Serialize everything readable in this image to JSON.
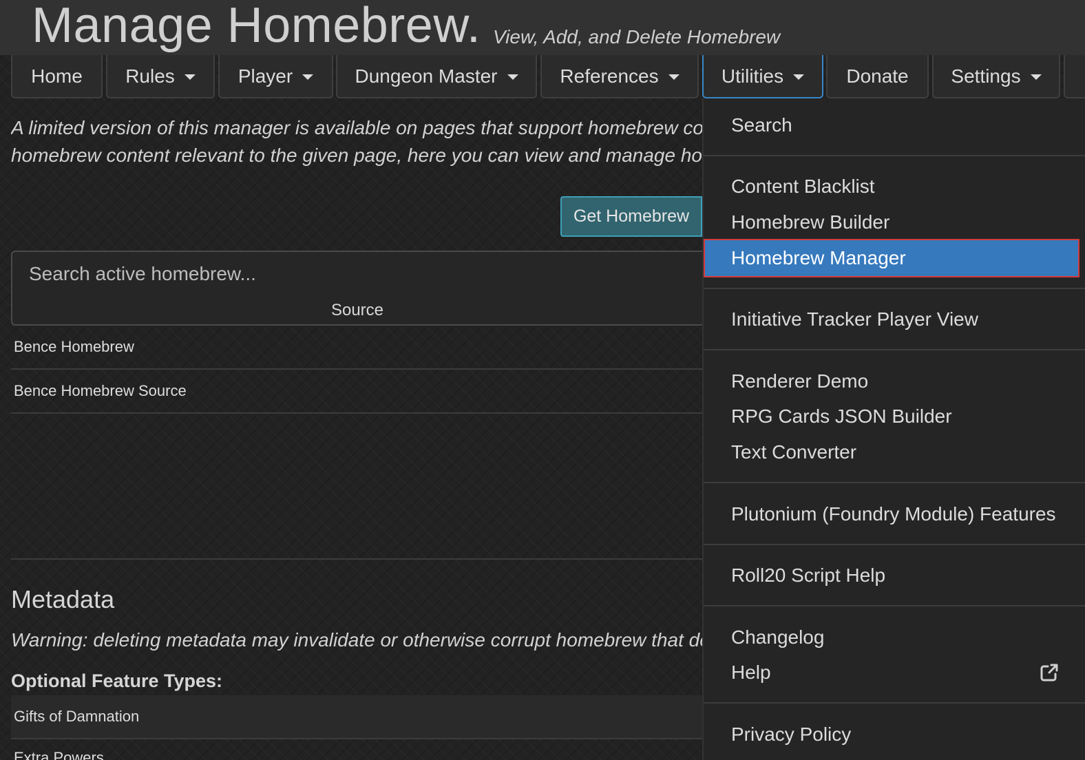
{
  "header": {
    "title": "Manage Homebrew.",
    "subtitle": "View, Add, and Delete Homebrew"
  },
  "nav": {
    "tabs": [
      {
        "label": "Home",
        "has_caret": false
      },
      {
        "label": "Rules",
        "has_caret": true
      },
      {
        "label": "Player",
        "has_caret": true
      },
      {
        "label": "Dungeon Master",
        "has_caret": true
      },
      {
        "label": "References",
        "has_caret": true
      },
      {
        "label": "Utilities",
        "has_caret": true,
        "active": true
      },
      {
        "label": "Donate",
        "has_caret": false
      },
      {
        "label": "Settings",
        "has_caret": true
      }
    ]
  },
  "main": {
    "intro_line1": "A limited version of this manager is available on pages that support homebrew co",
    "intro_line2": "homebrew content relevant to the given page, here you can view and manage hor",
    "get_homebrew_label": "Get Homebrew",
    "search_placeholder": "Search active homebrew...",
    "column_header": "Source",
    "rows": [
      "Bence Homebrew",
      "Bence Homebrew Source"
    ]
  },
  "metadata": {
    "title": "Metadata",
    "warning": "Warning: deleting metadata may invalidate or otherwise corrupt homebrew that de",
    "feature_types_label": "Optional Feature Types:",
    "feature_rows": [
      "Gifts of Damnation",
      "Extra Powers"
    ]
  },
  "dropdown": {
    "items": {
      "search": "Search",
      "content_blacklist": "Content Blacklist",
      "homebrew_builder": "Homebrew Builder",
      "homebrew_manager": "Homebrew Manager",
      "initiative_tracker": "Initiative Tracker Player View",
      "renderer_demo": "Renderer Demo",
      "rpg_cards": "RPG Cards JSON Builder",
      "text_converter": "Text Converter",
      "plutonium": "Plutonium (Foundry Module) Features",
      "roll20": "Roll20 Script Help",
      "changelog": "Changelog",
      "help": "Help",
      "privacy": "Privacy Policy"
    },
    "selected": "Homebrew Manager",
    "help_icon": "external-link-icon"
  },
  "colors": {
    "accent": "#3679bd",
    "selected_outline": "#d23b3b",
    "button_bg": "#31646f",
    "button_border": "#3ea0b8"
  }
}
